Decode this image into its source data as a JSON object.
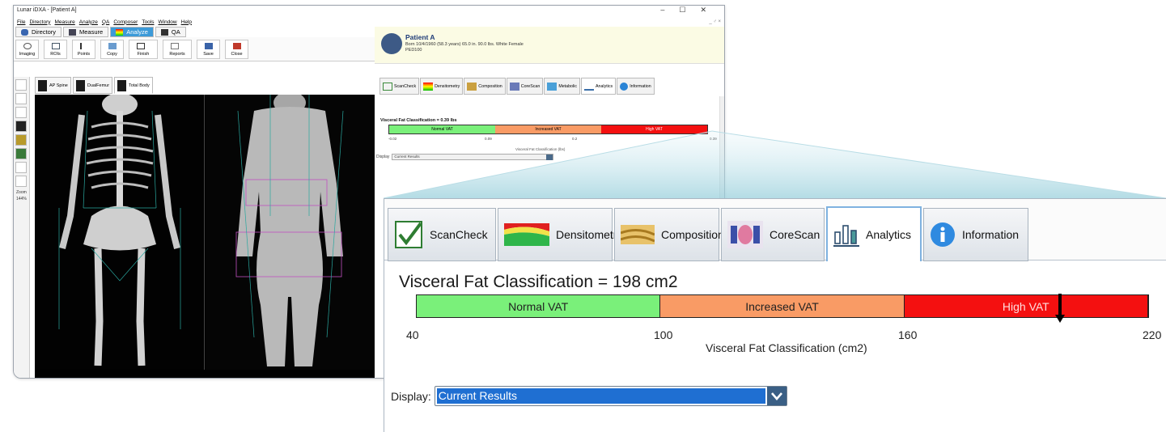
{
  "window": {
    "title": "Lunar iDXA - [Patient A]",
    "controls": [
      "–",
      "☐",
      "✕"
    ]
  },
  "menu": [
    "File",
    "Directory",
    "Measure",
    "Analyze",
    "QA",
    "Composer",
    "Tools",
    "Window",
    "Help"
  ],
  "mdi_controls": "_ ♂ ×",
  "main_tabs": [
    "Directory",
    "Measure",
    "Analyze",
    "QA"
  ],
  "toolbar": [
    "Imaging",
    "ROIs",
    "Points",
    "Copy",
    "Finish",
    "Reports",
    "Save",
    "Close"
  ],
  "tool_zoom_label": "Zoom",
  "tool_zoom_value": "144%",
  "scan_tabs": [
    "AP Spine",
    "DualFemur",
    "Total Body"
  ],
  "patient": {
    "name": "Patient A",
    "details": "Born 10/4/1960 (58.3 years)    65.0 in. 90.0 lbs.    White Female",
    "id": "PED100"
  },
  "result_tabs": [
    "ScanCheck",
    "Densitometry",
    "Composition",
    "CoreScan",
    "Metabolic",
    "Analytics",
    "Information"
  ],
  "small_panel": {
    "title": "Visceral Fat Classification = 0.39 lbs",
    "segments": [
      "Normal VAT",
      "Increased VAT",
      "High VAT"
    ],
    "ticks": [
      "-0.02",
      "0.09",
      "0.2",
      "0.39"
    ],
    "axis_label": "Visceral Fat Classification (lbs)",
    "display_label": "Display",
    "display_value": "Current Results"
  },
  "zoom_tabs": [
    "ScanCheck",
    "Densitometry",
    "Composition",
    "CoreScan",
    "Analytics",
    "Information"
  ],
  "zoom_panel": {
    "title": "Visceral Fat Classification = 198 cm2",
    "segments": [
      "Normal VAT",
      "Increased VAT",
      "High VAT"
    ],
    "segment_colors": [
      "#7af07a",
      "#f99b65",
      "#f41010"
    ],
    "ticks": [
      "40",
      "100",
      "160",
      "220"
    ],
    "marker_value": 198,
    "axis_label": "Visceral Fat Classification (cm2)",
    "display_label": "Display:",
    "display_value": "Current Results"
  },
  "colors": {
    "active_tab": "#3c9ad8",
    "patient_bg": "#fbfbe4",
    "select_highlight": "#1f6fd2"
  }
}
